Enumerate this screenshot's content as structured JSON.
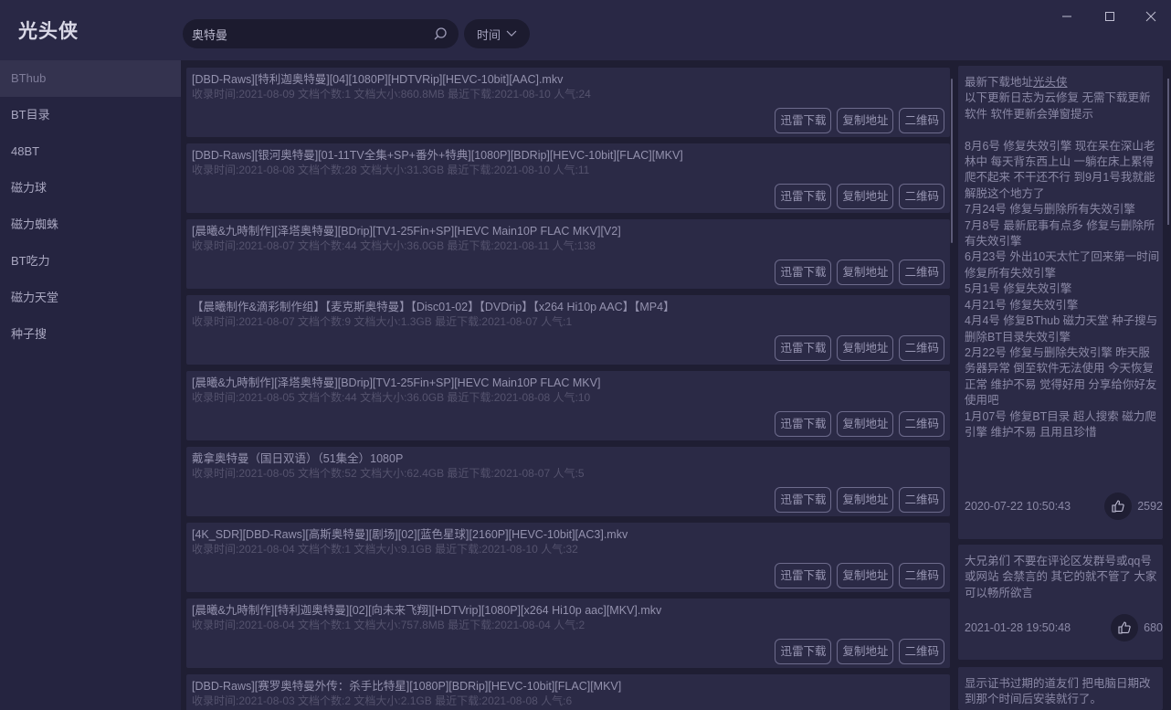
{
  "app": {
    "title": "光头侠"
  },
  "search": {
    "value": "奥特曼"
  },
  "filter": {
    "label": "时间"
  },
  "sidebar": {
    "items": [
      {
        "label": "BThub"
      },
      {
        "label": "BT目录"
      },
      {
        "label": "48BT"
      },
      {
        "label": "磁力球"
      },
      {
        "label": "磁力蜘蛛"
      },
      {
        "label": "BT吃力"
      },
      {
        "label": "磁力天堂"
      },
      {
        "label": "种子搜"
      }
    ]
  },
  "buttons": {
    "thunder": "迅雷下载",
    "copy": "复制地址",
    "qrcode": "二维码"
  },
  "results": [
    {
      "title": "[DBD-Raws][特利迦奥特曼][04][1080P][HDTVRip][HEVC-10bit][AAC].mkv",
      "meta": "收录时间:2021-08-09 文档个数:1 文档大小:860.8MB 最近下载:2021-08-10 人气:24"
    },
    {
      "title": "[DBD-Raws][银河奥特曼][01-11TV全集+SP+番外+特典][1080P][BDRip][HEVC-10bit][FLAC][MKV]",
      "meta": "收录时间:2021-08-08 文档个数:28 文档大小:31.3GB 最近下载:2021-08-10 人气:11"
    },
    {
      "title": "[晨曦&九時制作][泽塔奥特曼][BDrip][TV1-25Fin+SP][HEVC Main10P FLAC MKV][V2]",
      "meta": "收录时间:2021-08-07 文档个数:44 文档大小:36.0GB 最近下载:2021-08-11 人气:138"
    },
    {
      "title": "【晨曦制作&滴彩制作组】【麦克斯奥特曼】【Disc01-02】【DVDrip】【x264 Hi10p AAC】【MP4】",
      "meta": "收录时间:2021-08-07 文档个数:9 文档大小:1.3GB 最近下载:2021-08-07 人气:1"
    },
    {
      "title": "[晨曦&九時制作][泽塔奥特曼][BDrip][TV1-25Fin+SP][HEVC Main10P FLAC MKV]",
      "meta": "收录时间:2021-08-05 文档个数:44 文档大小:36.0GB 最近下载:2021-08-08 人气:10"
    },
    {
      "title": "戴拿奥特曼（国日双语）（51集全）1080P",
      "meta": "收录时间:2021-08-05 文档个数:52 文档大小:62.4GB 最近下载:2021-08-07 人气:5"
    },
    {
      "title": "[4K_SDR][DBD-Raws][高斯奥特曼][剧场][02][蓝色星球][2160P][HEVC-10bit][AC3].mkv",
      "meta": "收录时间:2021-08-04 文档个数:1 文档大小:9.1GB 最近下载:2021-08-10 人气:32"
    },
    {
      "title": "[晨曦&九時制作][特利迦奥特曼][02][向未来飞翔][HDTVrip][1080P][x264 Hi10p aac][MKV].mkv",
      "meta": "收录时间:2021-08-04 文档个数:1 文档大小:757.8MB 最近下载:2021-08-04 人气:2"
    },
    {
      "title": "[DBD-Raws][赛罗奥特曼外传：杀手比特星][1080P][BDRip][HEVC-10bit][FLAC][MKV]",
      "meta": "收录时间:2021-08-03 文档个数:2 文档大小:2.1GB 最近下载:2021-08-08 人气:6"
    }
  ],
  "notes": [
    {
      "prefix": "最新下载地址",
      "link": "光头侠",
      "text": "以下更新日志为云修复 无需下载更新软件 软件更新会弹窗提示\n\n8月6号 修复失效引擎 现在呆在深山老林中 每天背东西上山 一躺在床上累得爬不起来 不干还不行 到9月1号我就能解脱这个地方了\n7月24号 修复与删除所有失效引擎\n7月8号 最新屁事有点多 修复与删除所有失效引擎\n6月23号 外出10天太忙了回来第一时间 修复所有失效引擎\n5月1号 修复失效引擎\n4月21号 修复失效引擎\n4月4号 修复BThub 磁力天堂 种子搜与删除BT目录失效引擎\n2月22号 修复与删除失效引擎 昨天服务器异常 倒至软件无法使用 今天恢复正常 维护不易 觉得好用 分享给你好友使用吧\n1月07号 修复BT目录 超人搜索 磁力爬引擎 维护不易 且用且珍惜",
      "time": "2020-07-22 10:50:43",
      "likes": "2592"
    },
    {
      "text": "大兄弟们 不要在评论区发群号或qq号或网站 会禁言的 其它的就不管了 大家可以畅所欲言",
      "time": "2021-01-28 19:50:48",
      "likes": "680"
    },
    {
      "text": "显示证书过期的道友们 把电脑日期改到那个时间后安装就行了。"
    }
  ]
}
